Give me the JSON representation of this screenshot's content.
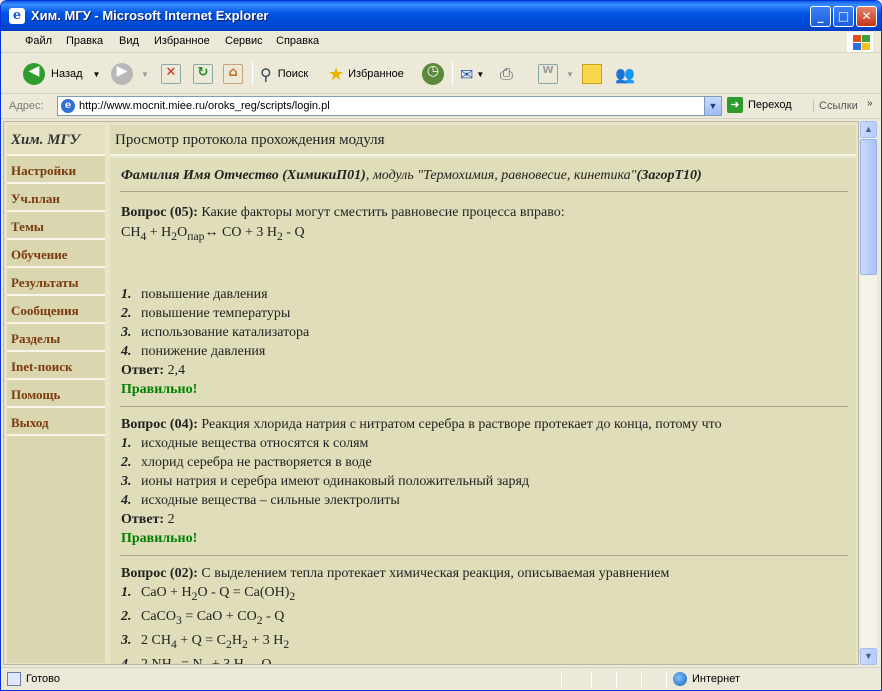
{
  "window": {
    "title": "Хим. МГУ - Microsoft Internet Explorer",
    "buttons": {
      "minimize": "_",
      "maximize": "□",
      "close": "✕"
    }
  },
  "menu": [
    "Файл",
    "Правка",
    "Вид",
    "Избранное",
    "Сервис",
    "Справка"
  ],
  "toolbar": {
    "back": "Назад",
    "search": "Поиск",
    "favorites": "Избранное"
  },
  "address": {
    "label": "Адрес:",
    "url": "http://www.mocnit.miee.ru/oroks_reg/scripts/login.pl",
    "go": "Переход",
    "links": "Ссылки"
  },
  "sidebar": {
    "title": "Хим. МГУ",
    "items": [
      "Настройки",
      "Уч.план",
      "Темы",
      "Обучение",
      "Результаты",
      "Сообщения",
      "Разделы",
      "Inet-поиск",
      "Помощь",
      "Выход"
    ]
  },
  "page": {
    "heading": "Просмотр протокола прохождения модуля",
    "student_name": "Фамилия Имя Отчество (ХимикиП01)",
    "module_text": ", модуль \"Термохимия, равновесие, кинетика\"",
    "module_code": "(ЗагорТ10)",
    "answer_label": "Ответ:",
    "correct_text": "Правильно!"
  },
  "questions": [
    {
      "label": "Вопрос (05):",
      "text": " Какие факторы могут сместить равновесие процесса вправо:",
      "options": [
        "повышение давления",
        "повышение температуры",
        "использование катализатора",
        "понижение давления"
      ],
      "answer": "2,4"
    },
    {
      "label": "Вопрос (04):",
      "text": " Реакция хлорида натрия с нитратом серебра в растворе протекает до конца, потому что",
      "options": [
        "исходные вещества относятся к солям",
        "хлорид серебра не растворяется в воде",
        "ионы натрия и серебра имеют одинаковый положительный заряд",
        "исходные вещества – сильные электролиты"
      ],
      "answer": "2"
    },
    {
      "label": "Вопрос (02):",
      "text": " С выделением тепла протекает химическая реакция, описываемая уравнением"
    }
  ],
  "option_numbers": [
    "1.",
    "2.",
    "3.",
    "4."
  ],
  "status": {
    "text": "Готово",
    "zone": "Интернет"
  }
}
